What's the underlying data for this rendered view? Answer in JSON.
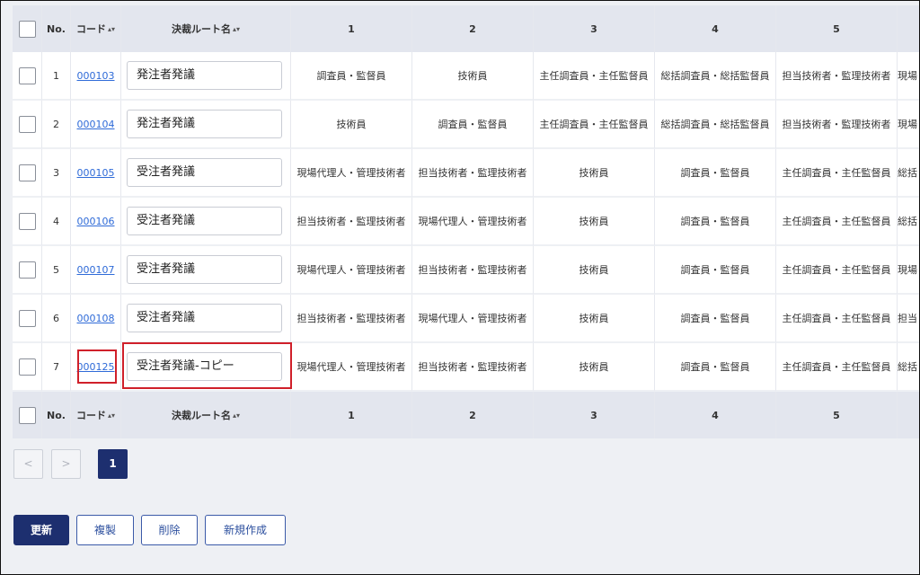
{
  "columns": {
    "no": "No.",
    "code": "コード",
    "name": "決裁ルート名",
    "c1": "1",
    "c2": "2",
    "c3": "3",
    "c4": "4",
    "c5": "5",
    "c6": ""
  },
  "rows": [
    {
      "no": "1",
      "code": "000103",
      "name": "発注者発議",
      "c1": "調査員・監督員",
      "c2": "技術員",
      "c3": "主任調査員・主任監督員",
      "c4": "総括調査員・総括監督員",
      "c5": "担当技術者・監理技術者",
      "c6": "現場"
    },
    {
      "no": "2",
      "code": "000104",
      "name": "発注者発議",
      "c1": "技術員",
      "c2": "調査員・監督員",
      "c3": "主任調査員・主任監督員",
      "c4": "総括調査員・総括監督員",
      "c5": "担当技術者・監理技術者",
      "c6": "現場"
    },
    {
      "no": "3",
      "code": "000105",
      "name": "受注者発議",
      "c1": "現場代理人・管理技術者",
      "c2": "担当技術者・監理技術者",
      "c3": "技術員",
      "c4": "調査員・監督員",
      "c5": "主任調査員・主任監督員",
      "c6": "総括"
    },
    {
      "no": "4",
      "code": "000106",
      "name": "受注者発議",
      "c1": "担当技術者・監理技術者",
      "c2": "現場代理人・管理技術者",
      "c3": "技術員",
      "c4": "調査員・監督員",
      "c5": "主任調査員・主任監督員",
      "c6": "総括"
    },
    {
      "no": "5",
      "code": "000107",
      "name": "受注者発議",
      "c1": "現場代理人・管理技術者",
      "c2": "担当技術者・監理技術者",
      "c3": "技術員",
      "c4": "調査員・監督員",
      "c5": "主任調査員・主任監督員",
      "c6": "現場"
    },
    {
      "no": "6",
      "code": "000108",
      "name": "受注者発議",
      "c1": "担当技術者・監理技術者",
      "c2": "現場代理人・管理技術者",
      "c3": "技術員",
      "c4": "調査員・監督員",
      "c5": "主任調査員・主任監督員",
      "c6": "担当"
    },
    {
      "no": "7",
      "code": "000125",
      "name": "受注者発議-コピー",
      "c1": "現場代理人・管理技術者",
      "c2": "担当技術者・監理技術者",
      "c3": "技術員",
      "c4": "調査員・監督員",
      "c5": "主任調査員・主任監督員",
      "c6": "総括"
    }
  ],
  "pagination": {
    "prev": "<",
    "next": ">",
    "current": "1"
  },
  "actions": {
    "update": "更新",
    "duplicate": "複製",
    "delete": "削除",
    "create": "新規作成"
  },
  "sort_glyph": "▴▾",
  "colors": {
    "primary": "#1d2f6f",
    "link": "#2f6bd8",
    "highlight": "#d0202a"
  }
}
